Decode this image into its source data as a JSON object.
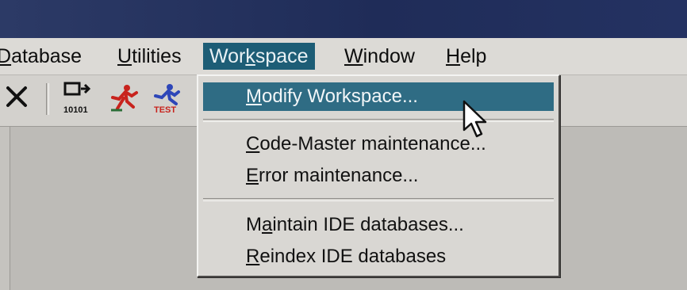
{
  "menubar": {
    "items": [
      {
        "label": "Database",
        "underline": "D"
      },
      {
        "label": "Utilities",
        "underline": "U"
      },
      {
        "label": "Workspace",
        "underline": "k"
      },
      {
        "label": "Window",
        "underline": "W"
      },
      {
        "label": "Help",
        "underline": "H"
      }
    ]
  },
  "toolbar": {
    "buttons": [
      {
        "icon": "close-x-icon"
      },
      {
        "icon": "binary-export-icon",
        "caption": "10101"
      },
      {
        "icon": "run-icon"
      },
      {
        "icon": "test-run-icon",
        "caption": "TEST"
      }
    ]
  },
  "workspace_menu": {
    "items": [
      {
        "label": "Modify Workspace...",
        "underline": "M",
        "highlighted": true
      },
      {
        "label": "Code-Master maintenance...",
        "underline": "C"
      },
      {
        "label": "Error maintenance...",
        "underline": "E"
      },
      {
        "label": "Maintain IDE databases...",
        "underline": "a"
      },
      {
        "label": "Reindex IDE databases",
        "underline": "R"
      }
    ]
  },
  "colors": {
    "titlebar": "#1f2c58",
    "highlight": "#2f6c84",
    "menu_background": "#d9d7d3"
  }
}
